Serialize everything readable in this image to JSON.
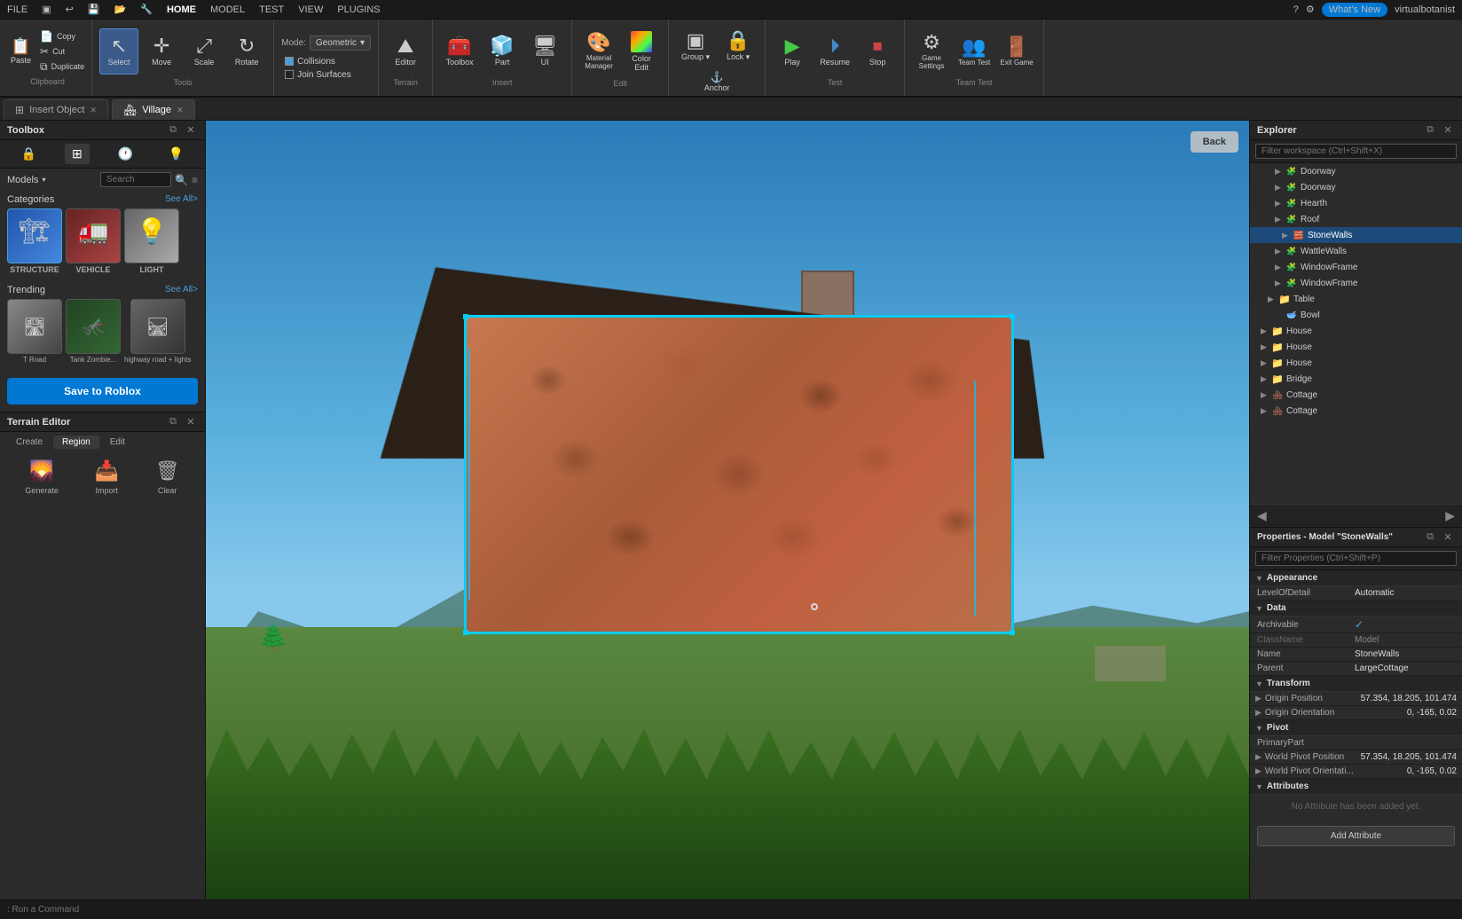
{
  "topbar": {
    "items": [
      "FILE",
      "▣",
      "↩",
      "🖫",
      "▣",
      "▣",
      "HOME",
      "MODEL",
      "TEST",
      "VIEW",
      "PLUGINS"
    ],
    "right": {
      "whats_new": "What's New",
      "user": "virtualbotanist"
    }
  },
  "toolbar": {
    "clipboard": {
      "paste_label": "Paste",
      "copy_label": "Copy",
      "cut_label": "Cut",
      "duplicate_label": "Duplicate",
      "section_label": "Clipboard"
    },
    "tools": {
      "select_label": "Select",
      "move_label": "Move",
      "scale_label": "Scale",
      "rotate_label": "Rotate",
      "section_label": "Tools"
    },
    "mode": {
      "label": "Mode:",
      "value": "Geometric",
      "collisions": "Collisions",
      "join_surfaces": "Join Surfaces"
    },
    "terrain": {
      "editor_label": "Editor",
      "section_label": "Terrain"
    },
    "toolbox_label": "Toolbox",
    "part_label": "Part",
    "ui_label": "UI",
    "material_manager_label": "Material\nManager",
    "color_edit_label": "Color\nEdit",
    "group_label": "Group",
    "lock_label": "Lock",
    "anchor_label": "Anchor",
    "insert_label": "Insert",
    "play_label": "Play",
    "resume_label": "Resume",
    "stop_label": "Stop",
    "test_label": "Test",
    "game_settings_label": "Game\nSettings",
    "team_test_label": "Team\nTest",
    "exit_game_label": "Exit\nGame",
    "settings_label": "Settings",
    "team_label": "Team\nTest"
  },
  "tabs": [
    {
      "label": "Insert Object",
      "icon": "⊞",
      "active": false,
      "closeable": true
    },
    {
      "label": "Village",
      "icon": "🏘",
      "active": true,
      "closeable": true
    }
  ],
  "toolbox": {
    "title": "Toolbox",
    "tabs": [
      {
        "label": "🔒",
        "active": false
      },
      {
        "label": "⊞",
        "active": true
      },
      {
        "label": "🕐",
        "active": false
      },
      {
        "label": "💡",
        "active": false
      }
    ],
    "models_label": "Models",
    "search_placeholder": "Search",
    "categories_label": "Categories",
    "see_all": "See All>",
    "categories": [
      {
        "label": "STRUCTURE",
        "color": "#44a0cc"
      },
      {
        "label": "VEHICLE",
        "color": "#cc4444"
      },
      {
        "label": "LIGHT",
        "color": "#cccccc"
      }
    ],
    "trending_label": "Trending",
    "trending": [
      {
        "label": "T Road"
      },
      {
        "label": "Tank\nZombie..."
      },
      {
        "label": "highway\nroad + lights"
      }
    ],
    "save_btn": "Save to Roblox"
  },
  "terrain_editor": {
    "title": "Terrain Editor",
    "tabs": [
      "Create",
      "Region",
      "Edit"
    ],
    "active_tab": "Region",
    "tools": [
      {
        "label": "Generate"
      },
      {
        "label": "Import"
      },
      {
        "label": "Clear"
      }
    ]
  },
  "viewport": {
    "back_btn": "Back"
  },
  "explorer": {
    "title": "Explorer",
    "filter_placeholder": "Filter workspace (Ctrl+Shift+X)",
    "items": [
      {
        "label": "Doorway",
        "indent": 3,
        "type": "mesh"
      },
      {
        "label": "Doorway",
        "indent": 3,
        "type": "mesh"
      },
      {
        "label": "Hearth",
        "indent": 3,
        "type": "mesh"
      },
      {
        "label": "Roof",
        "indent": 3,
        "type": "mesh"
      },
      {
        "label": "StoneWalls",
        "indent": 3,
        "type": "mesh",
        "selected": true
      },
      {
        "label": "WattleWalls",
        "indent": 3,
        "type": "mesh"
      },
      {
        "label": "WindowFrame",
        "indent": 3,
        "type": "mesh"
      },
      {
        "label": "WindowFrame",
        "indent": 3,
        "type": "mesh"
      },
      {
        "label": "Table",
        "indent": 2,
        "type": "folder"
      },
      {
        "label": "Bowl",
        "indent": 3,
        "type": "mesh"
      },
      {
        "label": "House",
        "indent": 1,
        "type": "folder"
      },
      {
        "label": "House",
        "indent": 1,
        "type": "folder"
      },
      {
        "label": "House",
        "indent": 1,
        "type": "folder"
      },
      {
        "label": "Bridge",
        "indent": 1,
        "type": "folder"
      },
      {
        "label": "Cottage",
        "indent": 1,
        "type": "folder"
      },
      {
        "label": "Cottage",
        "indent": 1,
        "type": "folder"
      }
    ]
  },
  "properties": {
    "title": "Properties - Model \"StoneWalls\"",
    "filter_placeholder": "Filter Properties (Ctrl+Shift+P)",
    "sections": {
      "appearance": {
        "label": "Appearance",
        "rows": [
          {
            "name": "LevelOfDetail",
            "value": "Automatic"
          }
        ]
      },
      "data": {
        "label": "Data",
        "rows": [
          {
            "name": "Archivable",
            "value": "✓",
            "is_check": true
          },
          {
            "name": "ClassName",
            "value": "Model",
            "dimmed": true
          },
          {
            "name": "Name",
            "value": "StoneWalls"
          },
          {
            "name": "Parent",
            "value": "LargeCottage"
          }
        ]
      },
      "transform": {
        "label": "Transform",
        "rows": [
          {
            "name": "Origin Position",
            "value": "57.354, 18.205, 101.474",
            "expandable": true
          },
          {
            "name": "Origin Orientation",
            "value": "0, -165, 0.02",
            "expandable": true
          }
        ]
      },
      "pivot": {
        "label": "Pivot",
        "rows": [
          {
            "name": "PrimaryPart",
            "value": ""
          },
          {
            "name": "World Pivot Position",
            "value": "57.354, 18.205, 101.474",
            "expandable": true
          },
          {
            "name": "World Pivot Orientati...",
            "value": "0, -165, 0.02",
            "expandable": true
          }
        ]
      },
      "attributes": {
        "label": "Attributes",
        "no_attr_text": "No Attribute has been added yet.",
        "add_btn": "Add Attribute"
      }
    }
  },
  "bottombar": {
    "placeholder": ": Run a Command"
  }
}
